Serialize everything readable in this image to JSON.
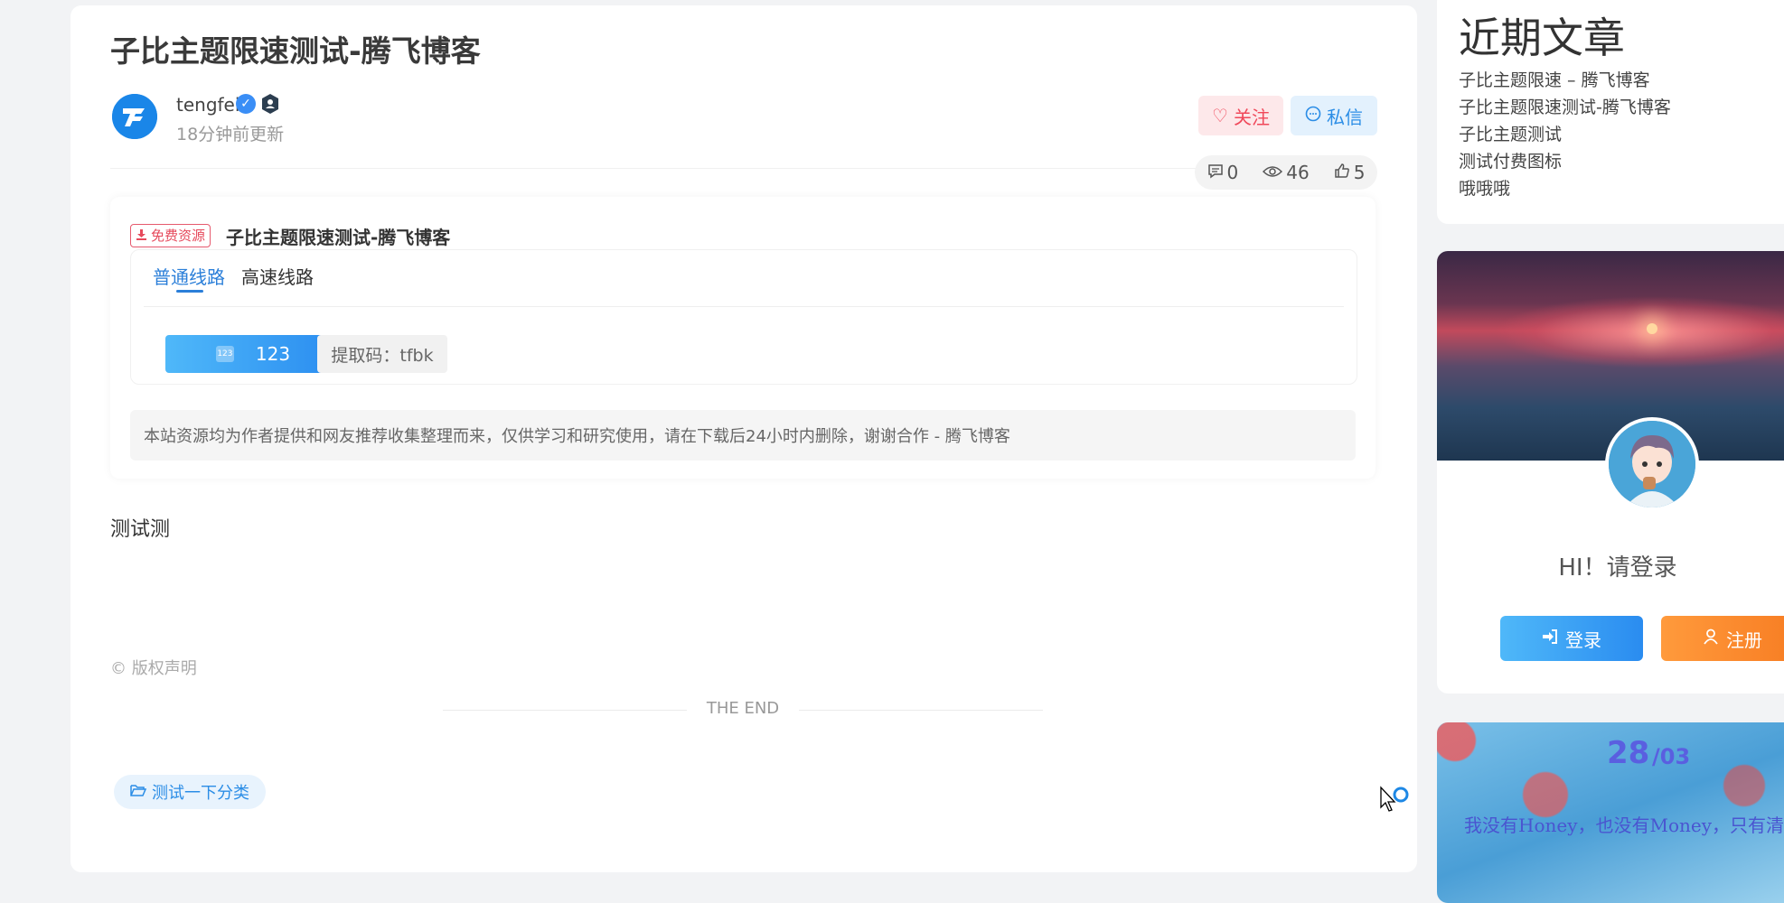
{
  "article": {
    "title": "子比主题限速测试-腾飞博客",
    "author": {
      "name": "tengfei",
      "update_time": "18分钟前更新"
    },
    "actions": {
      "follow": "关注",
      "message": "私信"
    },
    "stats": {
      "comments": "0",
      "views": "46",
      "likes": "5"
    },
    "download": {
      "free_tag": "免费资源",
      "title": "子比主题限速测试-腾飞博客",
      "tabs": [
        {
          "label": "普通线路",
          "active": true
        },
        {
          "label": "高速线路",
          "active": false
        }
      ],
      "button_label": "123",
      "extract_code": "提取码：tfbk",
      "notice": "本站资源均为作者提供和网友推荐收集整理而来，仅供学习和研究使用，请在下载后24小时内删除，谢谢合作 - 腾飞博客"
    },
    "content": "测试测",
    "copyright": "© 版权声明",
    "the_end": "THE END",
    "category": "测试一下分类"
  },
  "sidebar": {
    "recent": {
      "title": "近期文章",
      "items": [
        "子比主题限速 – 腾飞博客",
        "子比主题限速测试-腾飞博客",
        "子比主题测试",
        "测试付费图标",
        "哦哦哦"
      ]
    },
    "user": {
      "greeting": "HI！请登录",
      "login": "登录",
      "register": "注册"
    },
    "calendar": {
      "day": "28",
      "month": "/03",
      "quote": "我没有Honey，也没有Money，只有清"
    }
  },
  "colors": {
    "accent_blue": "#2b8de6",
    "follow_red": "#f0485a",
    "register_orange": "#f77c22"
  }
}
